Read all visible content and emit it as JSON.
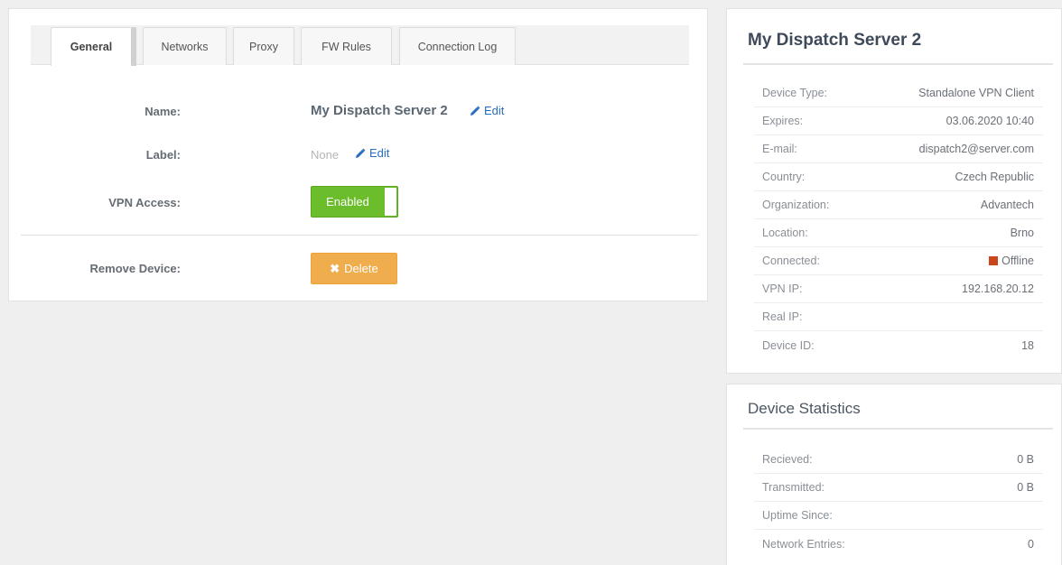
{
  "tabs": {
    "general": "General",
    "networks": "Networks",
    "proxy": "Proxy",
    "fw_rules": "FW Rules",
    "connection_log": "Connection Log"
  },
  "form": {
    "name_label": "Name:",
    "name_value": "My Dispatch Server 2",
    "label_label": "Label:",
    "label_value": "None",
    "edit_text": "Edit",
    "vpn_label": "VPN Access:",
    "vpn_toggle": "Enabled",
    "remove_label": "Remove Device:",
    "delete_button": "Delete"
  },
  "device_info": {
    "title": "My Dispatch Server 2",
    "rows": [
      {
        "key": "Device Type:",
        "value": "Standalone VPN Client"
      },
      {
        "key": "Expires:",
        "value": "03.06.2020 10:40"
      },
      {
        "key": "E-mail:",
        "value": "dispatch2@server.com"
      },
      {
        "key": "Country:",
        "value": "Czech Republic"
      },
      {
        "key": "Organization:",
        "value": "Advantech"
      },
      {
        "key": "Location:",
        "value": "Brno"
      },
      {
        "key": "Connected:",
        "value": "Offline"
      },
      {
        "key": "VPN IP:",
        "value": "192.168.20.12"
      },
      {
        "key": "Real IP:",
        "value": ""
      },
      {
        "key": "Device ID:",
        "value": "18"
      }
    ]
  },
  "device_stats": {
    "title": "Device Statistics",
    "rows": [
      {
        "key": "Recieved:",
        "value": "0 B"
      },
      {
        "key": "Transmitted:",
        "value": "0 B"
      },
      {
        "key": "Uptime Since:",
        "value": ""
      },
      {
        "key": "Network Entries:",
        "value": "0"
      }
    ]
  },
  "colors": {
    "enabled_green": "#6cbd2b",
    "delete_orange": "#f0ad4e",
    "offline_red": "#c9461d",
    "link_blue": "#2a6fbd"
  },
  "icons": {
    "edit": "pencil-icon",
    "delete": "times-icon",
    "status": "offline-square-icon"
  }
}
